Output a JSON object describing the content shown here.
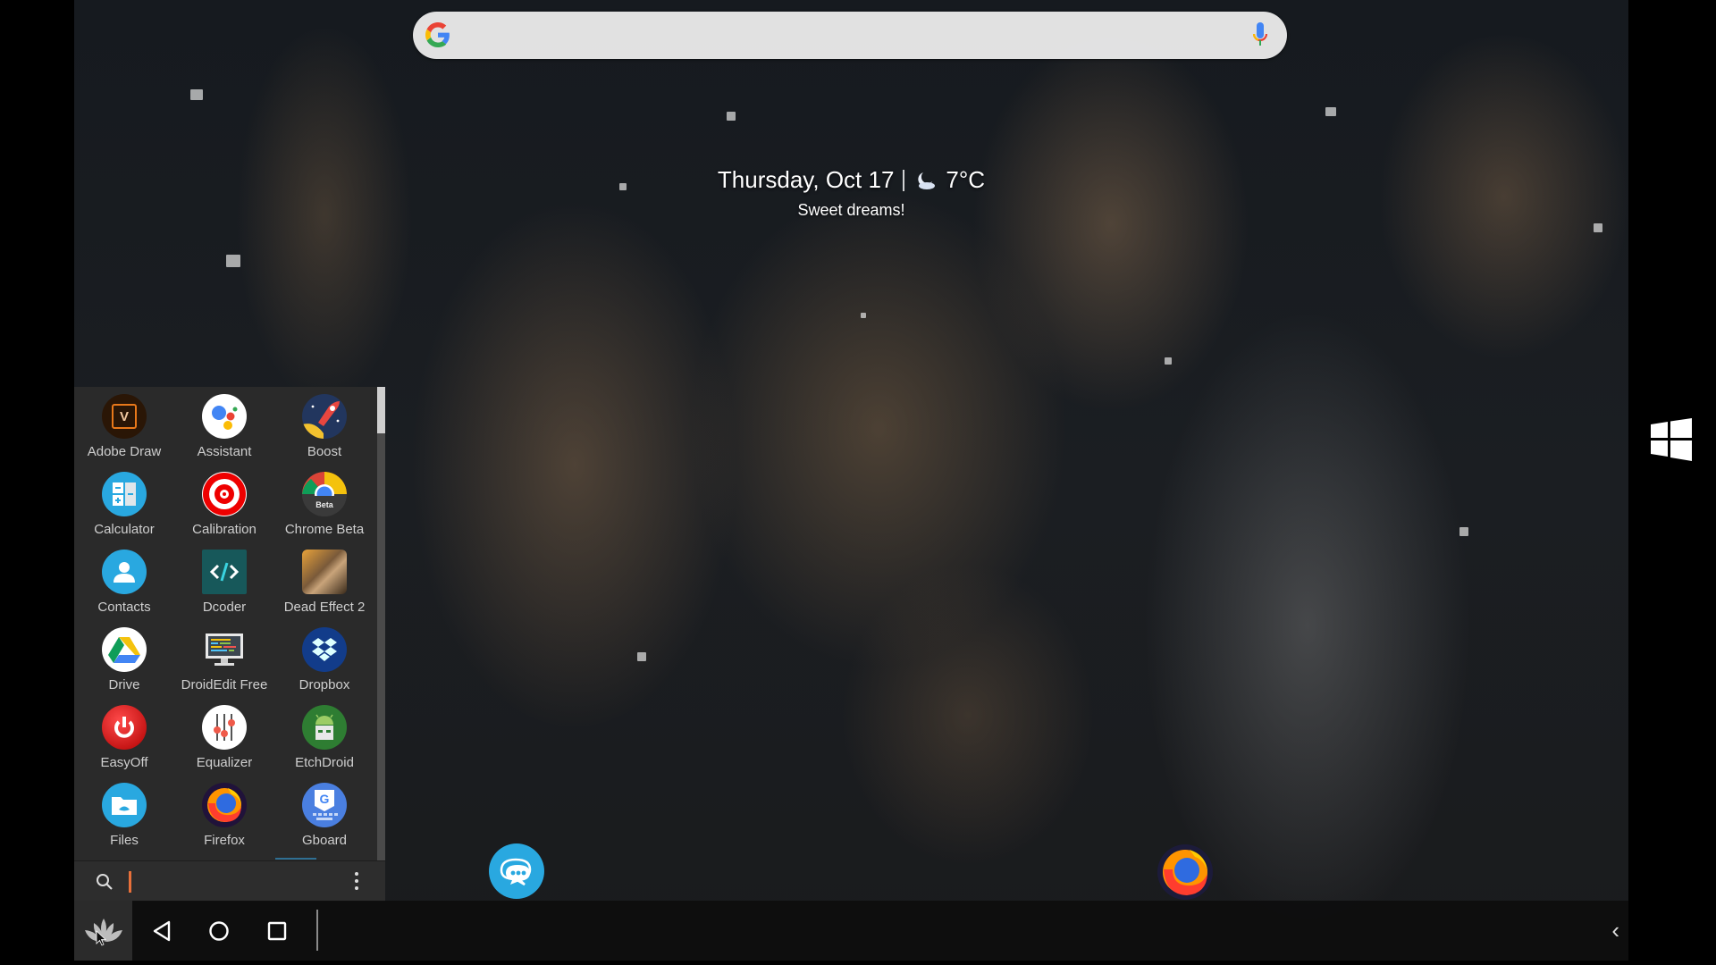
{
  "search_bar": {
    "logo": "google-g-icon",
    "mic": "microphone-icon"
  },
  "date_widget": {
    "date": "Thursday, Oct 17",
    "weather_icon": "moon-cloud-icon",
    "temperature": "7°C",
    "greeting": "Sweet dreams!"
  },
  "app_drawer": {
    "apps": [
      {
        "label": "Adobe Draw",
        "icon": "adobe-draw-icon"
      },
      {
        "label": "Assistant",
        "icon": "assistant-icon"
      },
      {
        "label": "Boost",
        "icon": "boost-rocket-icon"
      },
      {
        "label": "Calculator",
        "icon": "calculator-icon"
      },
      {
        "label": "Calibration",
        "icon": "calibration-target-icon"
      },
      {
        "label": "Chrome Beta",
        "icon": "chrome-beta-icon"
      },
      {
        "label": "Contacts",
        "icon": "contacts-icon"
      },
      {
        "label": "Dcoder",
        "icon": "dcoder-icon"
      },
      {
        "label": "Dead Effect 2",
        "icon": "dead-effect-2-icon"
      },
      {
        "label": "Drive",
        "icon": "drive-icon"
      },
      {
        "label": "DroidEdit Free",
        "icon": "droidedit-icon"
      },
      {
        "label": "Dropbox",
        "icon": "dropbox-icon"
      },
      {
        "label": "EasyOff",
        "icon": "easyoff-power-icon"
      },
      {
        "label": "Equalizer",
        "icon": "equalizer-icon"
      },
      {
        "label": "EtchDroid",
        "icon": "etchdroid-icon"
      },
      {
        "label": "Files",
        "icon": "files-folder-icon"
      },
      {
        "label": "Firefox",
        "icon": "firefox-icon"
      },
      {
        "label": "Gboard",
        "icon": "gboard-icon"
      }
    ],
    "chrome_beta_badge": "Beta",
    "search_placeholder": "",
    "search_value": ""
  },
  "dock": [
    {
      "name": "messaging",
      "icon": "chat-bubbles-icon"
    },
    {
      "name": "firefox",
      "icon": "firefox-icon"
    }
  ],
  "taskbar": {
    "start": "lotus-start-icon",
    "nav": [
      "back-icon",
      "home-icon",
      "recents-icon"
    ],
    "overflow": "‹"
  },
  "side_panel": {
    "icon": "windows-logo-icon"
  },
  "colors": {
    "drawer_bg": "#2a2a2a",
    "caret": "#e8703a",
    "accent_blue": "#29a8e0"
  }
}
